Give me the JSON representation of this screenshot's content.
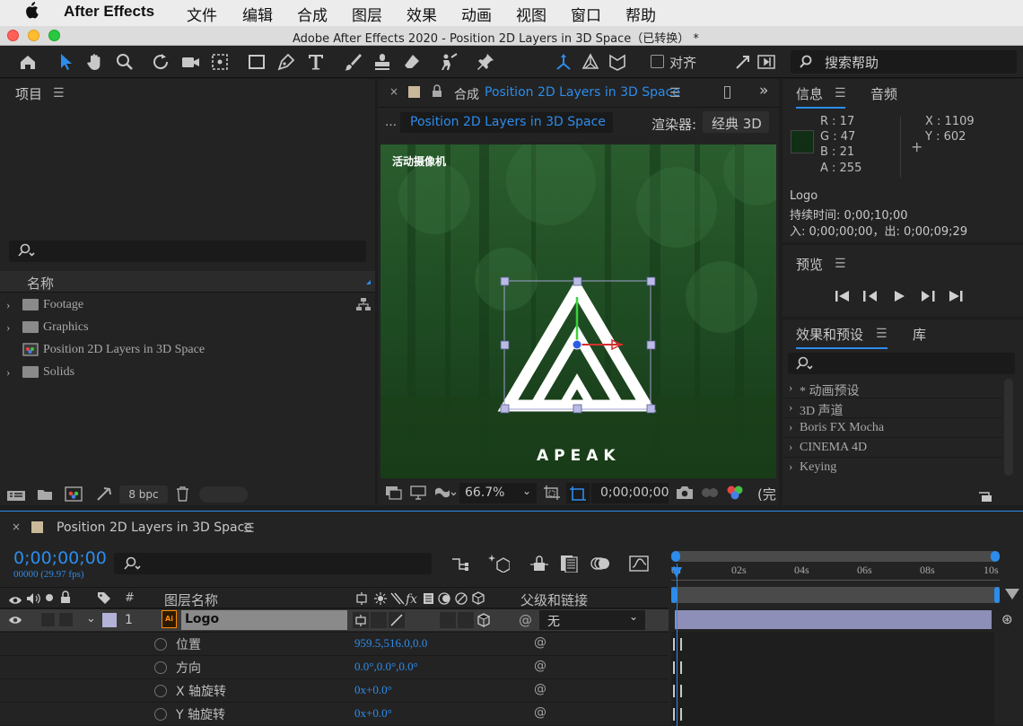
{
  "menubar": {
    "app_name": "After Effects",
    "items": [
      "文件",
      "编辑",
      "合成",
      "图层",
      "效果",
      "动画",
      "视图",
      "窗口",
      "帮助"
    ]
  },
  "window": {
    "title": "Adobe After Effects 2020 - Position 2D Layers in 3D Space（已转换） *"
  },
  "toolbar": {
    "align_label": "对齐",
    "search_help": "搜索帮助"
  },
  "project": {
    "title": "项目",
    "column_name": "名称",
    "items": [
      {
        "name": "Footage",
        "type": "folder"
      },
      {
        "name": "Graphics",
        "type": "folder"
      },
      {
        "name": "Position 2D Layers in 3D Space",
        "type": "composition"
      },
      {
        "name": "Solids",
        "type": "folder"
      }
    ],
    "bpc": "8 bpc"
  },
  "composition": {
    "tab_prefix": "合成",
    "tab_name": "Position 2D Layers in 3D Space",
    "breadcrumb": "Position 2D Layers in 3D Space",
    "renderer_label": "渲染器:",
    "renderer_value": "经典 3D",
    "active_camera": "活动摄像机",
    "logo_text": "APEAK",
    "zoom": "66.7%",
    "timecode": "0;00;00;00",
    "quality": "(完"
  },
  "info": {
    "tab_info": "信息",
    "tab_audio": "音频",
    "r": "R :  17",
    "g": "G :  47",
    "b": "B :  21",
    "a": "A :  255",
    "x": "X : 1109",
    "y": "Y :  602",
    "swatch_color": "#112f15",
    "layer_name": "Logo",
    "duration": "持续时间: 0;00;10;00",
    "in_out": "入: 0;00;00;00，出: 0;00;09;29"
  },
  "preview": {
    "title": "预览"
  },
  "effects": {
    "tab_effects": "效果和预设",
    "tab_library": "库",
    "items": [
      "* 动画预设",
      "3D 声道",
      "Boris FX Mocha",
      "CINEMA 4D",
      "Keying"
    ]
  },
  "timeline": {
    "comp_name": "Position 2D Layers in 3D Space",
    "current_time": "0;00;00;00",
    "frame_info": "00000 (29.97 fps)",
    "col_hash": "#",
    "col_layer_name": "图层名称",
    "col_parent": "父级和链接",
    "ruler": [
      "0s",
      "02s",
      "04s",
      "06s",
      "08s",
      "10s"
    ],
    "layer": {
      "index": "1",
      "name": "Logo",
      "parent": "无",
      "label_color": "#b3b3d9"
    },
    "properties": [
      {
        "name": "位置",
        "value": "959.5,516.0,0.0"
      },
      {
        "name": "方向",
        "value": "0.0°,0.0°,0.0°"
      },
      {
        "name": "X 轴旋转",
        "value": "0x+0.0°"
      },
      {
        "name": "Y 轴旋转",
        "value": "0x+0.0°"
      }
    ]
  },
  "colors": {
    "accent": "#2d8ceb",
    "panel_bg": "#232323",
    "forest": "#1f4a22"
  }
}
